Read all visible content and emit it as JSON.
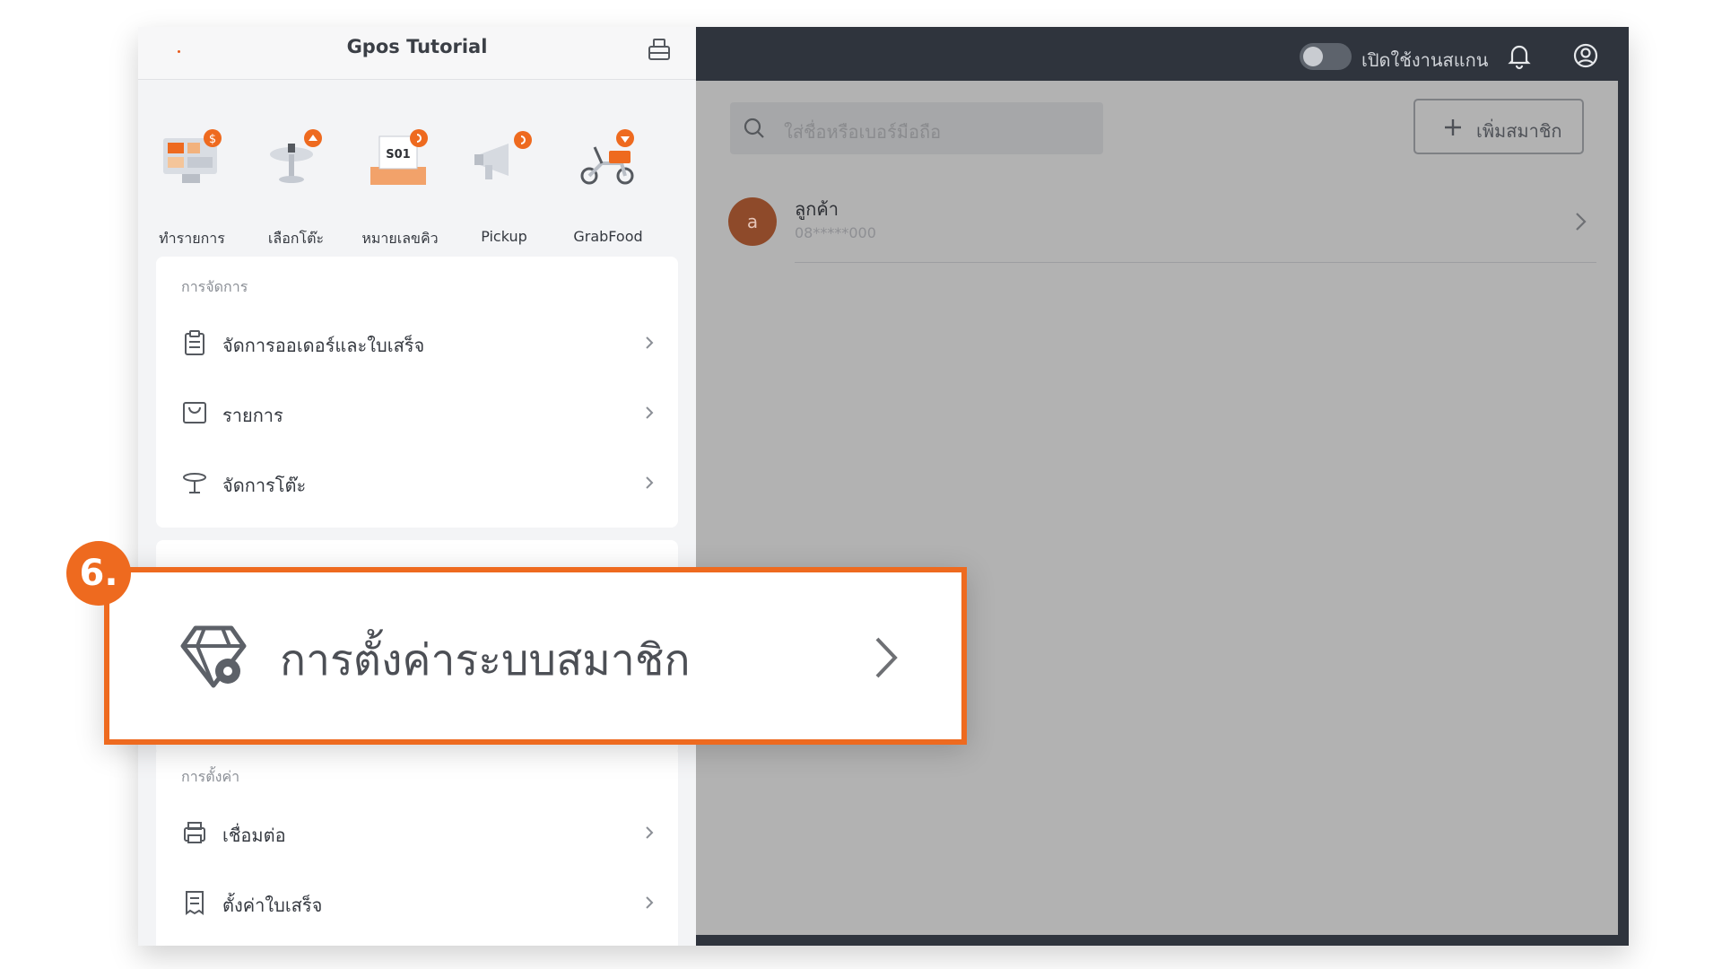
{
  "header": {
    "store_name": "Gpos Tutorial",
    "register_icon": "cash-register-icon"
  },
  "shortcuts": [
    {
      "label": "ทำรายการ",
      "icon": "pos-terminal-icon"
    },
    {
      "label": "เลือกโต๊ะ",
      "icon": "table-icon"
    },
    {
      "label": "หมายเลขคิว",
      "icon": "queue-ticket-icon",
      "ticket": "S01"
    },
    {
      "label": "Pickup",
      "icon": "megaphone-icon"
    },
    {
      "label": "GrabFood",
      "icon": "scooter-icon"
    }
  ],
  "management": {
    "title": "การจัดการ",
    "items": [
      {
        "label": "จัดการออเดอร์และใบเสร็จ",
        "icon": "clipboard-icon"
      },
      {
        "label": "รายการ",
        "icon": "bag-icon"
      },
      {
        "label": "จัดการโต๊ะ",
        "icon": "table-icon"
      }
    ]
  },
  "settings": {
    "title": "การตั้งค่า",
    "items": [
      {
        "label": "เชื่อมต่อ",
        "icon": "printer-icon"
      },
      {
        "label": "ตั้งค่าใบเสร็จ",
        "icon": "receipt-icon"
      }
    ]
  },
  "topbar": {
    "scan_label": "เปิดใช้งานสแกน",
    "scan_enabled": false
  },
  "members": {
    "search_placeholder": "ใส่ชื่อหรือเบอร์มือถือ",
    "add_label": "เพิ่มสมาชิก",
    "list": [
      {
        "avatar_letter": "a",
        "name": "ลูกค้า",
        "phone": "08*****000"
      }
    ]
  },
  "callout": {
    "step": "6.",
    "label": "การตั้งค่าระบบสมาชิก",
    "icon": "member-diamond-gear-icon"
  },
  "colors": {
    "accent": "#ee6a1f",
    "dark_bar": "#2f343d",
    "overlay_gray": "#b2b2b2"
  }
}
